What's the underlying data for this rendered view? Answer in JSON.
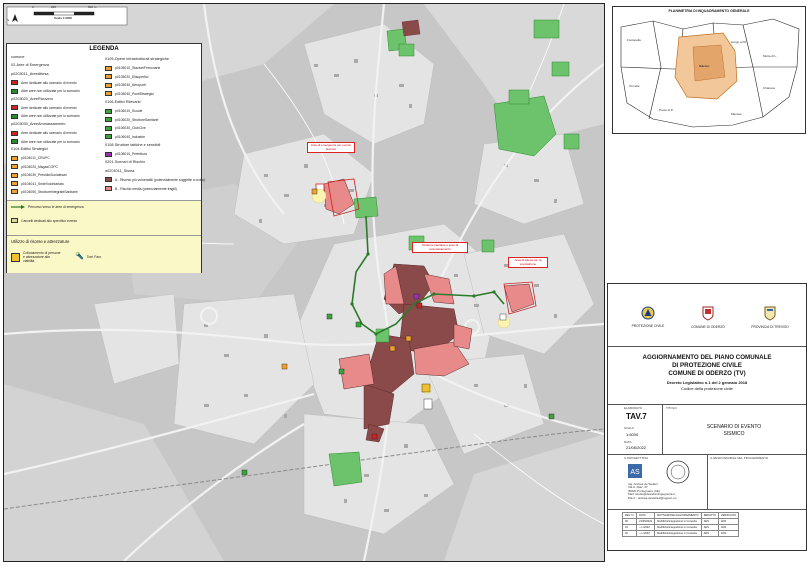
{
  "map": {
    "north_label": "N",
    "scale_label": "Scala 1:6000",
    "scale_ticks": [
      "0",
      "250",
      "500 m"
    ]
  },
  "legend": {
    "title": "LEGENDA",
    "left_column": [
      {
        "text": "comune",
        "kind": "head"
      },
      {
        "text": "02-Aree di Emergenza",
        "kind": "head"
      },
      {
        "text": "p0203011_AreeAttesa",
        "kind": "head"
      },
      {
        "text": "Aree dedicate allo scenario di evento",
        "kind": "item",
        "color": "#cc2222"
      },
      {
        "text": "Altre aree non utilizzate per lo scenario",
        "kind": "item",
        "color": "#2a8a2a"
      },
      {
        "text": "p0203020_AreeRicovero",
        "kind": "head"
      },
      {
        "text": "Aree dedicate allo scenario di evento",
        "kind": "item",
        "color": "#cc2222"
      },
      {
        "text": "Altre aree non utilizzate per lo scenario",
        "kind": "item",
        "color": "#2a8a2a"
      },
      {
        "text": "p0203030_AreeAmmassamento",
        "kind": "head"
      },
      {
        "text": "Aree dedicate allo scenario di evento",
        "kind": "item",
        "color": "#cc2222"
      },
      {
        "text": "Altre aree non utilizzate per lo scenario",
        "kind": "item",
        "color": "#2a8a2a"
      },
      {
        "text": "0104-Edifici Strategici",
        "kind": "head"
      },
      {
        "text": "p0104011_CRUPC",
        "kind": "item",
        "color": "#f0a030"
      },
      {
        "text": "p0104020_MagazCOPC",
        "kind": "item",
        "color": "#f0a030"
      },
      {
        "text": "p0104030_PresidioSocialesan",
        "kind": "item",
        "color": "#f0a030"
      },
      {
        "text": "p0104041_SedeVolontariato",
        "kind": "item",
        "color": "#f0a030"
      },
      {
        "text": "p0104050_StruttureIntegrateSanitarie",
        "kind": "item",
        "color": "#f0a030"
      }
    ],
    "right_column": [
      {
        "text": "0105-Opere infrastrutturali strategiche",
        "kind": "head"
      },
      {
        "text": "p0105010_StazioniFerroviarie",
        "kind": "item",
        "color": "#f0a030"
      },
      {
        "text": "p0105020_Elisuperfici",
        "kind": "item",
        "color": "#f0a030"
      },
      {
        "text": "p0105030_Aeroporti",
        "kind": "item",
        "color": "#f0a030"
      },
      {
        "text": "p0105040_PontiStrategici",
        "kind": "item",
        "color": "#f0a030"
      },
      {
        "text": "0106-Edifici Rilevanti",
        "kind": "head"
      },
      {
        "text": "p0106010_Scuole",
        "kind": "item",
        "color": "#3aa53a"
      },
      {
        "text": "p0106020_StruttureSanitarie",
        "kind": "item",
        "color": "#3aa53a"
      },
      {
        "text": "p0106030_ClubCive",
        "kind": "item",
        "color": "#3aa53a"
      },
      {
        "text": "p0106040_Industrie",
        "kind": "item",
        "color": "#3aa53a"
      },
      {
        "text": "0108-Strutture tattiche e sensibili",
        "kind": "head"
      },
      {
        "text": "p0108010_Prefettura",
        "kind": "item",
        "color": "#9933aa"
      },
      {
        "text": "0201-Scenari di Rischio",
        "kind": "head"
      },
      {
        "text": "a0201011_Sisma",
        "kind": "head"
      },
      {
        "text": "A - Rischio più vulnerabili (potenzialmente soggette a crollo)",
        "kind": "item",
        "color": "#8a4a4a"
      },
      {
        "text": "B - Rischio media (potenzialmente fragili)",
        "kind": "item",
        "color": "#e98a8a"
      }
    ],
    "route_label": "Percorso verso le aree di emergenza",
    "gate_label": "Cancelli dedicati allo specifico evento",
    "utility_title": "Utilizzo di risorse e attrezzature",
    "utility_items": [
      "Collocamento di persone e attrezzature alle viabilità",
      "Torri Faro"
    ]
  },
  "callouts": [
    "Aree di emergenza per evento sismico",
    "Strutture sanitarie e aree di ammassamento",
    "Area di attesa per la popolazione"
  ],
  "inset": {
    "title": "PLANIMETRIA DI INQUADRAMENTO GENERALE",
    "places": [
      "Fontanelle",
      "Gorgo al M.",
      "Motta di L.",
      "Chiarano",
      "Ormelle",
      "Ponte di P.",
      "Oderzo",
      "Mansuè"
    ]
  },
  "title_block": {
    "logos": [
      {
        "label": "PROTEZIONE CIVILE"
      },
      {
        "label": "COMUNE DI ODERZO"
      },
      {
        "label": "PROVINCIA DI TREVISO"
      }
    ],
    "title_lines": [
      "AGGIORNAMENTO DEL PIANO COMUNALE",
      "DI PROTEZIONE CIVILE",
      "COMUNE DI ODERZO (TV)"
    ],
    "subtitle_lines": [
      "Decreto Legislativo n.1 del 2 gennaio 2018",
      "Codice della protezione civile"
    ],
    "elaborato_label": "ELABORATO",
    "elaborato_value": "TAV.7",
    "titolo_label": "TITOLO",
    "scala_label": "SCALA",
    "scala_value": "1:6000",
    "data_label": "DATA",
    "data_value": "21/06/2022",
    "tavola_title": [
      "SCENARIO DI EVENTO",
      "SISMICO"
    ],
    "progettista_label": "IL PROGETTISTA",
    "responsabile_label": "IL RESPONSABILE DEL PROCEDIMENTO",
    "progettista_lines": [
      "Ing. Andrea de Stefani",
      "Via A. Diaz, 37",
      "30020 Portogruaro (VE)",
      "Mail: studio@destefaniingegneria.it",
      "P.E.C.: andrea.destefani@ingpec.eu"
    ],
    "revisions_header": [
      "REV. N.",
      "DATA",
      "MOTIVAZIONE AGGIORNAMENTO",
      "REDATTO",
      "VERIFICATO"
    ],
    "revisions": [
      [
        "00",
        "21/06/2022",
        "Modifiche/integrazione in Consulta",
        "ADS",
        "ADS"
      ],
      [
        "01",
        "--/--/2022",
        "Modifiche/integrazione in Consulta",
        "ADS",
        "ADS"
      ],
      [
        "02",
        "--/--/2022",
        "Modifiche/integrazione in Consulta",
        "ADS",
        "ADS"
      ]
    ]
  }
}
